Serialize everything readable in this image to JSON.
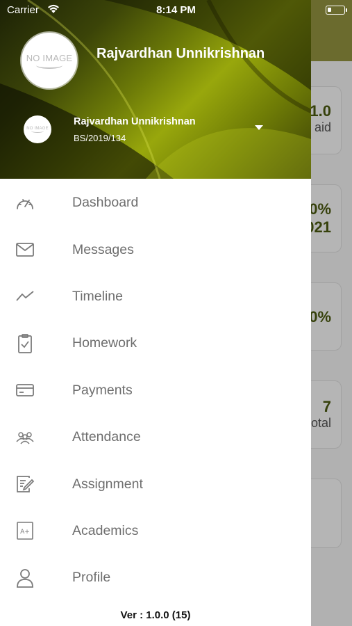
{
  "status_bar": {
    "carrier": "Carrier",
    "time": "8:14 PM"
  },
  "background": {
    "cards": [
      {
        "line1": "1.0",
        "line2": "aid"
      },
      {
        "line1": "0%",
        "line2": "021"
      },
      {
        "line1": "0%",
        "line2": ""
      },
      {
        "line1": "7",
        "line2": "otal"
      },
      {
        "line1": "",
        "line2": ""
      }
    ]
  },
  "drawer": {
    "header": {
      "name": "Rajvardhan Unnikrishnan",
      "avatar_text": "NO IMAGE",
      "student": {
        "name": "Rajvardhan Unnikrishnan",
        "id": "BS/2019/134"
      }
    },
    "menu": [
      {
        "label": "Dashboard",
        "icon": "gauge-icon"
      },
      {
        "label": "Messages",
        "icon": "envelope-icon"
      },
      {
        "label": "Timeline",
        "icon": "trend-icon"
      },
      {
        "label": "Homework",
        "icon": "clipboard-check-icon"
      },
      {
        "label": "Payments",
        "icon": "card-icon"
      },
      {
        "label": "Attendance",
        "icon": "group-icon"
      },
      {
        "label": "Assignment",
        "icon": "edit-note-icon"
      },
      {
        "label": "Academics",
        "icon": "grade-icon"
      },
      {
        "label": "Profile",
        "icon": "person-icon"
      }
    ],
    "version": "Ver : 1.0.0 (15)"
  },
  "colors": {
    "header_accent": "#98a70c",
    "label_gray": "#6e6e6e",
    "icon_gray": "#7a7a7a"
  }
}
